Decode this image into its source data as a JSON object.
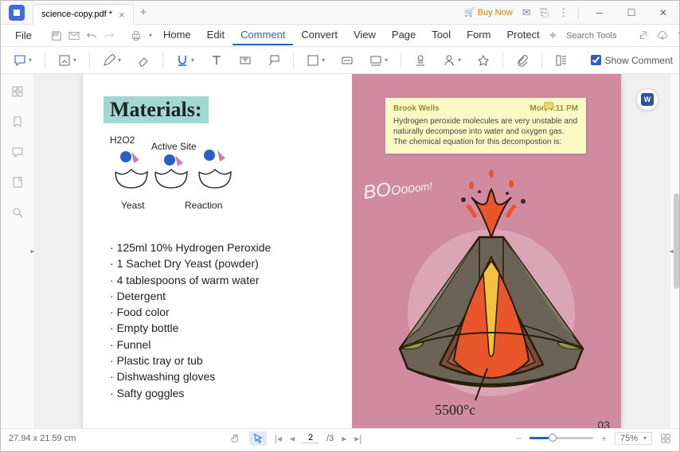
{
  "titlebar": {
    "tab_name": "science-copy.pdf *",
    "buy_now": "Buy Now"
  },
  "menubar": {
    "file": "File",
    "items": [
      "Home",
      "Edit",
      "Comment",
      "Convert",
      "View",
      "Page",
      "Tool",
      "Form",
      "Protect"
    ],
    "active_index": 2,
    "search_placeholder": "Search Tools"
  },
  "toolbar": {
    "show_comment": "Show Comment"
  },
  "page_left": {
    "materials_title": "Materials:",
    "labels": {
      "h2o2": "H2O2",
      "active_site": "Active Site",
      "yeast": "Yeast",
      "reaction": "Reaction"
    },
    "materials_list": [
      "125ml 10% Hydrogen Peroxide",
      "1 Sachet Dry Yeast (powder)",
      "4 tablespoons of warm water",
      "Detergent",
      "Food color",
      "Empty bottle",
      "Funnel",
      "Plastic tray or tub",
      "Dishwashing gloves",
      "Safty goggles"
    ]
  },
  "page_right": {
    "note_author": "Brook Wells",
    "note_time": "Mon 4:11 PM",
    "note_body": "Hydrogen peroxide molecules are very unstable and naturally decompose into water and oxygen gas. The chemical equation for this decompostion is:",
    "boom_big": "BO",
    "boom_med": "Ooo",
    "boom_sm": "om!",
    "temp": "5500°c",
    "page_num": "03"
  },
  "statusbar": {
    "dimensions": "27.94 x 21.59 cm",
    "page_current": "2",
    "page_total": "/3",
    "zoom": "75%"
  }
}
